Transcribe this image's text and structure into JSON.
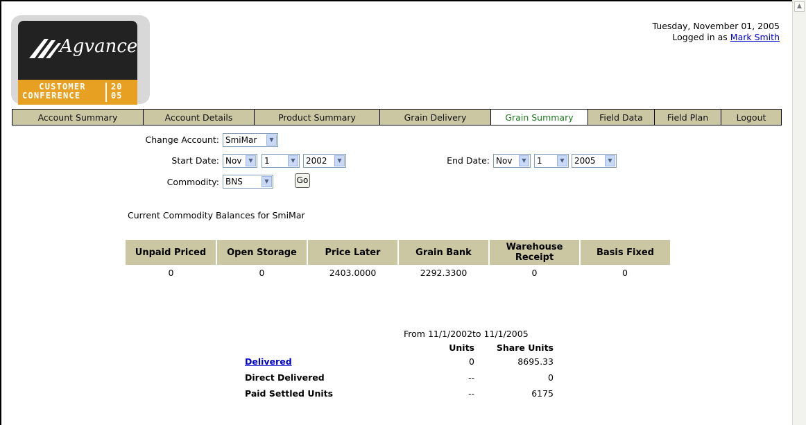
{
  "header": {
    "date": "Tuesday, November 01, 2005",
    "logged_in_prefix": "Logged in as",
    "user_name": "Mark Smith"
  },
  "logo": {
    "brand": "Agvance",
    "conference_line1": "CUSTOMER",
    "conference_line2": "CONFERENCE",
    "year_line1": "20",
    "year_line2": "05"
  },
  "nav": {
    "tabs": [
      {
        "label": "Account Summary",
        "active": false
      },
      {
        "label": "Account Details",
        "active": false
      },
      {
        "label": "Product Summary",
        "active": false
      },
      {
        "label": "Grain Delivery",
        "active": false
      },
      {
        "label": "Grain Summary",
        "active": true
      },
      {
        "label": "Field Data",
        "active": false
      },
      {
        "label": "Field Plan",
        "active": false
      },
      {
        "label": "Logout",
        "active": false
      }
    ]
  },
  "filters": {
    "change_account_label": "Change Account:",
    "account_value": "SmiMar",
    "start_date_label": "Start Date:",
    "start_month": "Nov",
    "start_day": "1",
    "start_year": "2002",
    "end_date_label": "End Date:",
    "end_month": "Nov",
    "end_day": "1",
    "end_year": "2005",
    "commodity_label": "Commodity:",
    "commodity_value": "BNS",
    "go_label": "Go"
  },
  "balances": {
    "title": "Current Commodity Balances for SmiMar",
    "headers": [
      "Unpaid Priced",
      "Open Storage",
      "Price Later",
      "Grain Bank",
      "Warehouse Receipt",
      "Basis Fixed"
    ],
    "values": [
      "0",
      "0",
      "2403.0000",
      "2292.3300",
      "0",
      "0"
    ]
  },
  "summary": {
    "range": "From 11/1/2002to 11/1/2005",
    "col_units": "Units",
    "col_share_units": "Share Units",
    "rows": [
      {
        "label": "Delivered",
        "units": "0",
        "share_units": "8695.33"
      },
      {
        "label": "Direct Delivered",
        "units": "--",
        "share_units": "0"
      },
      {
        "label": "Paid Settled Units",
        "units": "--",
        "share_units": "6175"
      }
    ]
  },
  "colors": {
    "nav_bg": "#cbc7a3",
    "active_tab_text": "#1a7a1a",
    "link": "#0000cc",
    "logo_orange": "#e8a023"
  }
}
